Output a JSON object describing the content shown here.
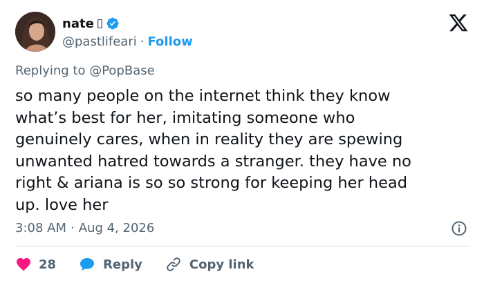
{
  "author": {
    "display_name": "nate",
    "name_glyph": "▯",
    "handle": "@pastlifeari",
    "separator": "·",
    "follow_label": "Follow"
  },
  "reply": {
    "prefix": "Replying to",
    "mention": "@PopBase"
  },
  "tweet": {
    "text": "so many people on the internet think they know\nwhat’s best for her, imitating someone who\ngenuinely cares, when in reality they are spewing\nunwanted hatred towards a stranger. they have no\nright & ariana is so so strong for keeping her head\nup. love her"
  },
  "meta": {
    "time": "3:08 AM",
    "separator": "·",
    "date": "Aug 4, 2026"
  },
  "actions": {
    "like_count": "28",
    "reply_label": "Reply",
    "copy_link_label": "Copy link"
  },
  "colors": {
    "like": "#f91880",
    "reply": "#1d9bf0",
    "verified": "#1d9bf0",
    "link": "#1d9bf0",
    "muted": "#536471"
  },
  "icons": [
    "verified-badge-icon",
    "x-logo-icon",
    "info-icon",
    "heart-icon",
    "reply-bubble-icon",
    "link-icon"
  ]
}
